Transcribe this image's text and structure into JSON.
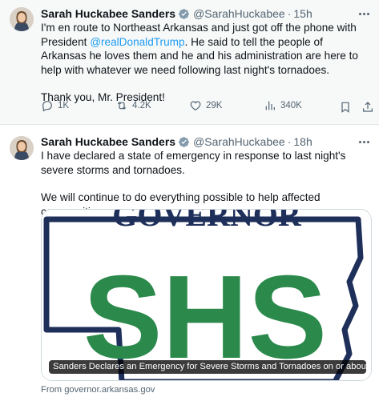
{
  "tweets": [
    {
      "author_name": "Sarah Huckabee Sanders",
      "handle": "@SarahHuckabee",
      "separator": "·",
      "time": "15h",
      "text_part1": "I'm en route to Northeast Arkansas and just got off the phone with President ",
      "mention": "@realDonaldTrump",
      "text_part2": ". He said to tell the people of Arkansas he loves them and he and his administration are here to help with whatever we need following last night's tornadoes.",
      "text_para2": "Thank you, Mr. President!",
      "replies": "1K",
      "reposts": "4.2K",
      "likes": "29K",
      "views": "340K"
    },
    {
      "author_name": "Sarah Huckabee Sanders",
      "handle": "@SarahHuckabee",
      "separator": "·",
      "time": "18h",
      "text_para1": "I have declared a state of emergency in response to last night's severe storms and tornadoes.",
      "text_para2": "We will continue to do everything possible to help affected communities.",
      "card": {
        "image_title": "GOVERNOR",
        "image_monogram": "SHS",
        "label": "Sanders Declares an Emergency for Severe Storms and Tornadoes on or about...",
        "source": "From governor.arkansas.gov"
      }
    }
  ],
  "colors": {
    "accent_blue": "#1d9bf0",
    "muted_gray": "#536471",
    "card_green": "#2b8a4b",
    "card_navy": "#1e2f5a"
  }
}
